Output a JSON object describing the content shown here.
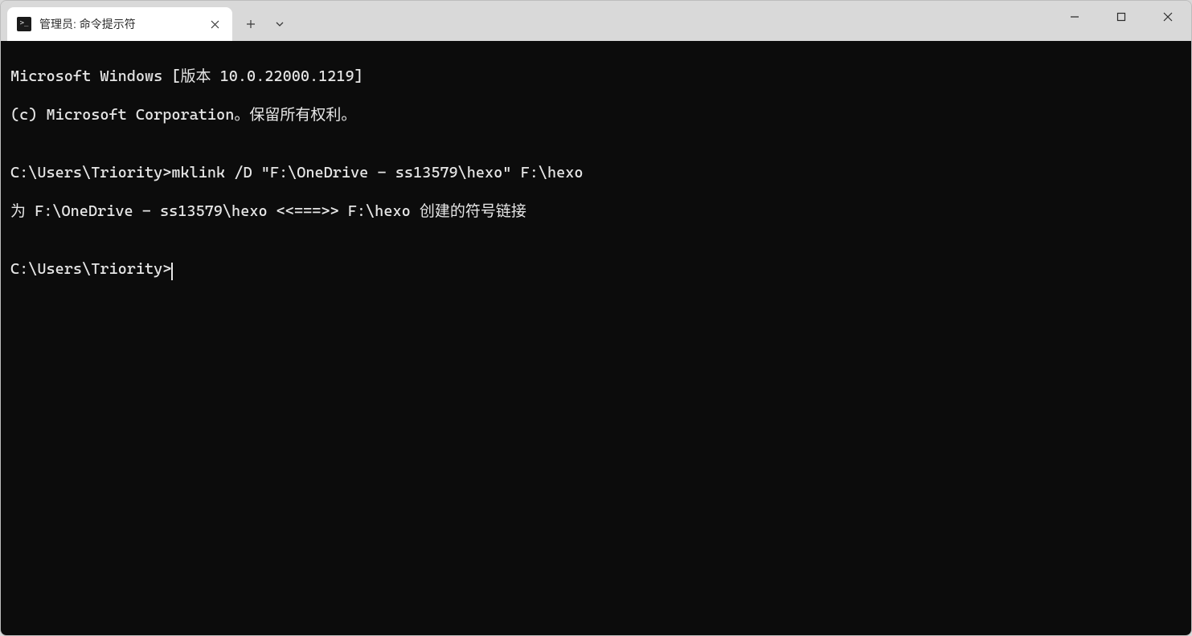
{
  "tab": {
    "title": "管理员: 命令提示符"
  },
  "terminal": {
    "line1": "Microsoft Windows [版本 10.0.22000.1219]",
    "line2": "(c) Microsoft Corporation。保留所有权利。",
    "blank1": "",
    "line3": "C:\\Users\\Triority>mklink /D \"F:\\OneDrive - ss13579\\hexo\" F:\\hexo",
    "line4": "为 F:\\OneDrive - ss13579\\hexo <<===>> F:\\hexo 创建的符号链接",
    "blank2": "",
    "prompt": "C:\\Users\\Triority>"
  }
}
